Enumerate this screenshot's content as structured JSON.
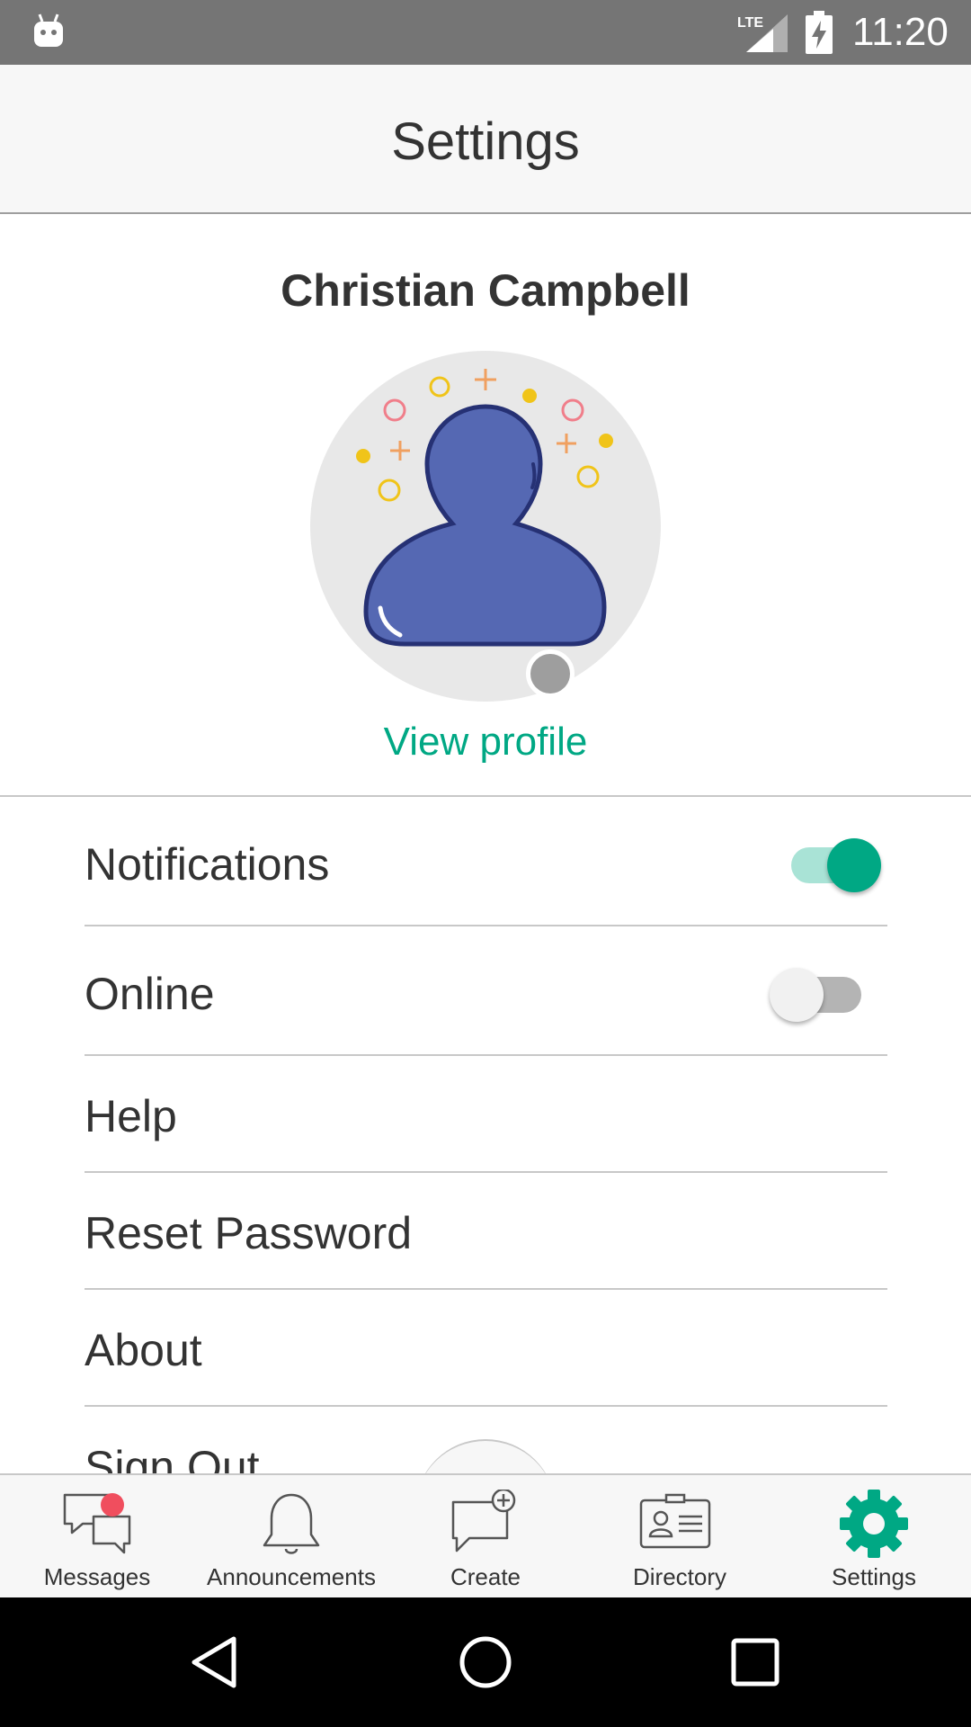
{
  "status_bar": {
    "time": "11:20",
    "network": "LTE"
  },
  "header": {
    "title": "Settings"
  },
  "profile": {
    "name": "Christian Campbell",
    "view_profile_label": "View profile"
  },
  "settings": {
    "notifications_label": "Notifications",
    "notifications_enabled": true,
    "online_label": "Online",
    "online_enabled": false,
    "help_label": "Help",
    "reset_password_label": "Reset Password",
    "about_label": "About",
    "sign_out_label": "Sign Out"
  },
  "bottom_nav": {
    "items": [
      {
        "label": "Messages",
        "icon": "messages-icon",
        "has_badge": true
      },
      {
        "label": "Announcements",
        "icon": "bell-icon"
      },
      {
        "label": "Create",
        "icon": "create-message-icon"
      },
      {
        "label": "Directory",
        "icon": "contact-card-icon"
      },
      {
        "label": "Settings",
        "icon": "gear-icon",
        "active": true
      }
    ]
  },
  "colors": {
    "accent": "#00a884",
    "avatar_fill": "#5568b3",
    "badge": "#f04e5e",
    "status_offline": "#9e9e9e"
  }
}
